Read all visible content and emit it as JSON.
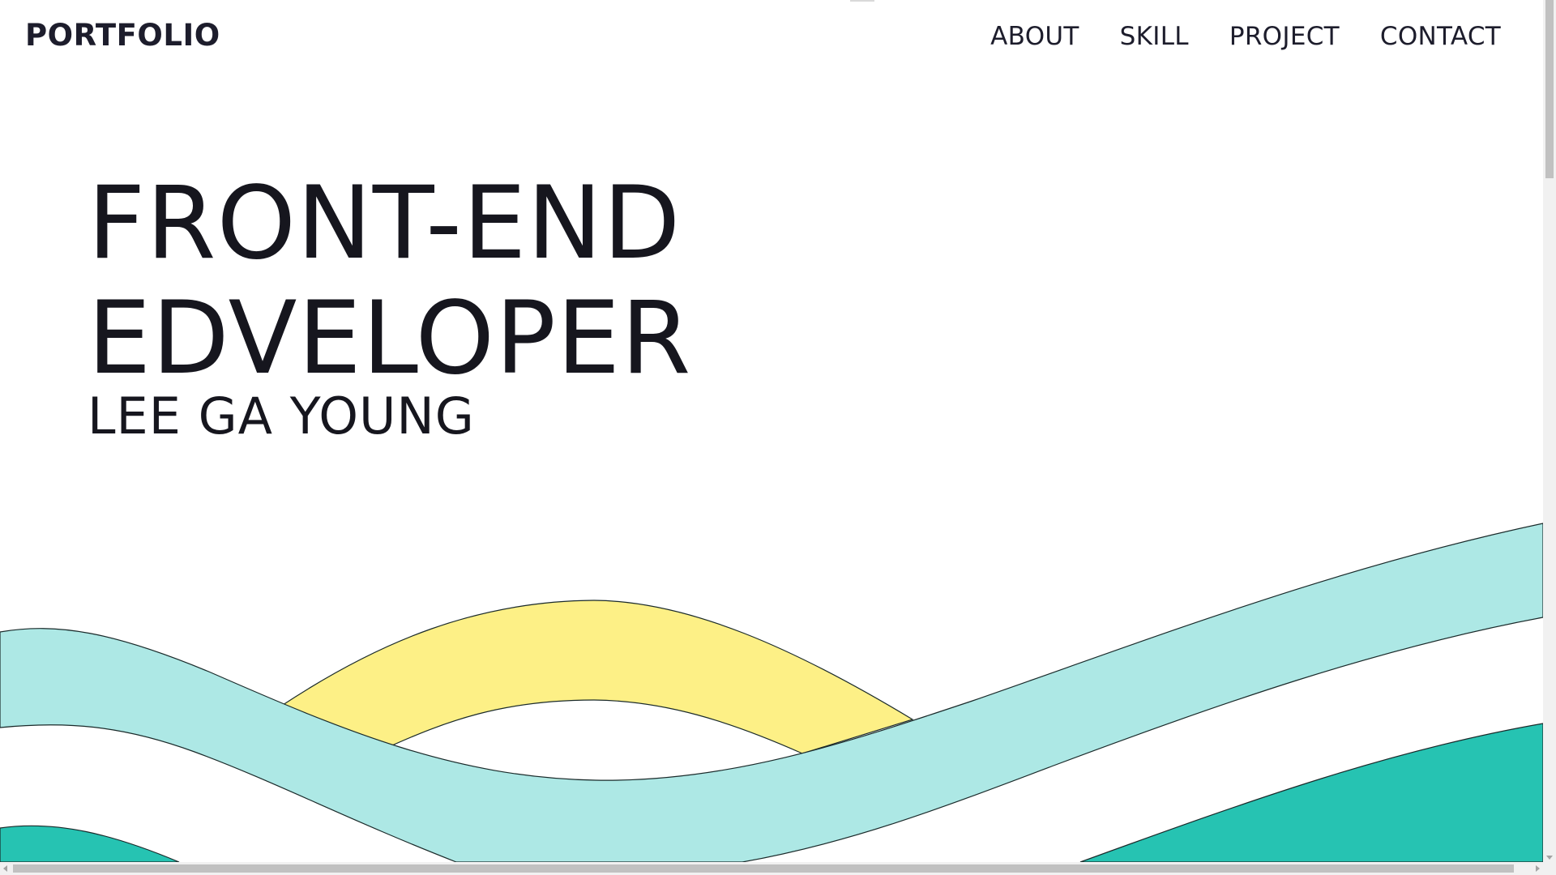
{
  "header": {
    "logo": "PORTFOLIO",
    "nav": [
      {
        "label": "ABOUT"
      },
      {
        "label": "SKILL"
      },
      {
        "label": "PROJECT"
      },
      {
        "label": "CONTACT"
      }
    ]
  },
  "hero": {
    "line1": "FRONT-END",
    "line2": "EDVELOPER",
    "name": "LEE GA YOUNG"
  },
  "colors": {
    "background": "#ffffff",
    "text": "#16161e",
    "wave_light": "#ade8e5",
    "wave_yellow": "#fdf086",
    "wave_teal": "#26c3b2",
    "wave_stroke": "#1a2a2a"
  }
}
